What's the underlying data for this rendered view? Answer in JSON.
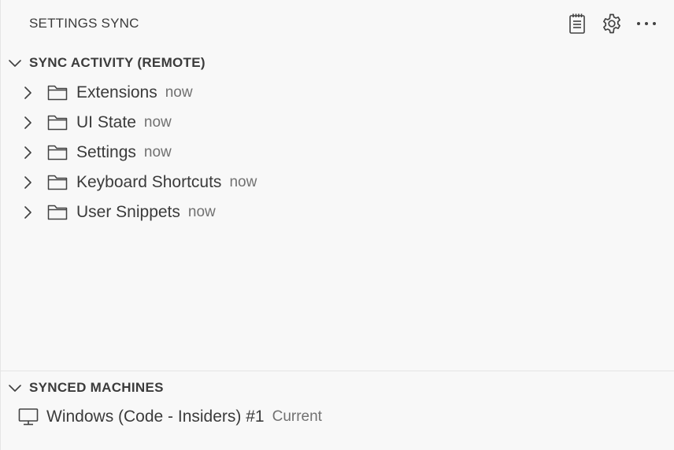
{
  "view": {
    "title": "SETTINGS SYNC"
  },
  "toolbar": {
    "actions": [
      {
        "icon": "notebook-icon",
        "label": ""
      },
      {
        "icon": "gear-icon",
        "label": ""
      },
      {
        "icon": "more-icon",
        "label": ""
      }
    ]
  },
  "sync_activity": {
    "header": "SYNC ACTIVITY (REMOTE)",
    "expanded": true,
    "items": [
      {
        "name": "Extensions",
        "time": "now"
      },
      {
        "name": "UI State",
        "time": "now"
      },
      {
        "name": "Settings",
        "time": "now"
      },
      {
        "name": "Keyboard Shortcuts",
        "time": "now"
      },
      {
        "name": "User Snippets",
        "time": "now"
      }
    ]
  },
  "synced_machines": {
    "header": "SYNCED MACHINES",
    "expanded": true,
    "items": [
      {
        "name": "Windows (Code - Insiders) #1",
        "badge": "Current"
      }
    ]
  },
  "colors": {
    "background": "#f8f8f8",
    "text": "#3b3b3b",
    "description": "#717171",
    "divider": "#e5e5e5"
  }
}
